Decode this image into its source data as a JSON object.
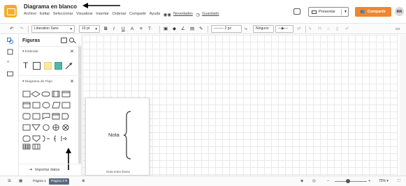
{
  "titlebar": {
    "doc_title": "Diagrama en blanco",
    "menu": [
      "Archivo",
      "Editar",
      "Seleccionar",
      "Visualizar",
      "Insertar",
      "Ordenar",
      "Compartir",
      "Ayuda"
    ],
    "novedades": "Novedades",
    "guardado": "Guardado",
    "present_label": "Presentar",
    "share_label": "Compartir",
    "avatar_initials": "MA",
    "accent_color": "#f0ae2a",
    "share_color": "#f08630"
  },
  "toolbar": {
    "font_family": "Liberation Sans",
    "font_size": "10 pt",
    "bold": "B",
    "italic": "I",
    "underline": "U",
    "font_color": "A",
    "align": "≡",
    "text_options": "T·",
    "line_width": "2 px",
    "arrow_start": "Ninguno"
  },
  "panel": {
    "heading": "Figuras",
    "section_standard": "Estándar",
    "section_flowchart": "Diagrama de Flujo",
    "import_label": "Importar datos"
  },
  "tooltip": {
    "shape_label": "Nota",
    "caption": "Nota entre llaves"
  },
  "bottombar": {
    "page1": "Página 1",
    "page2": "Página 2",
    "zoom": "75%"
  }
}
